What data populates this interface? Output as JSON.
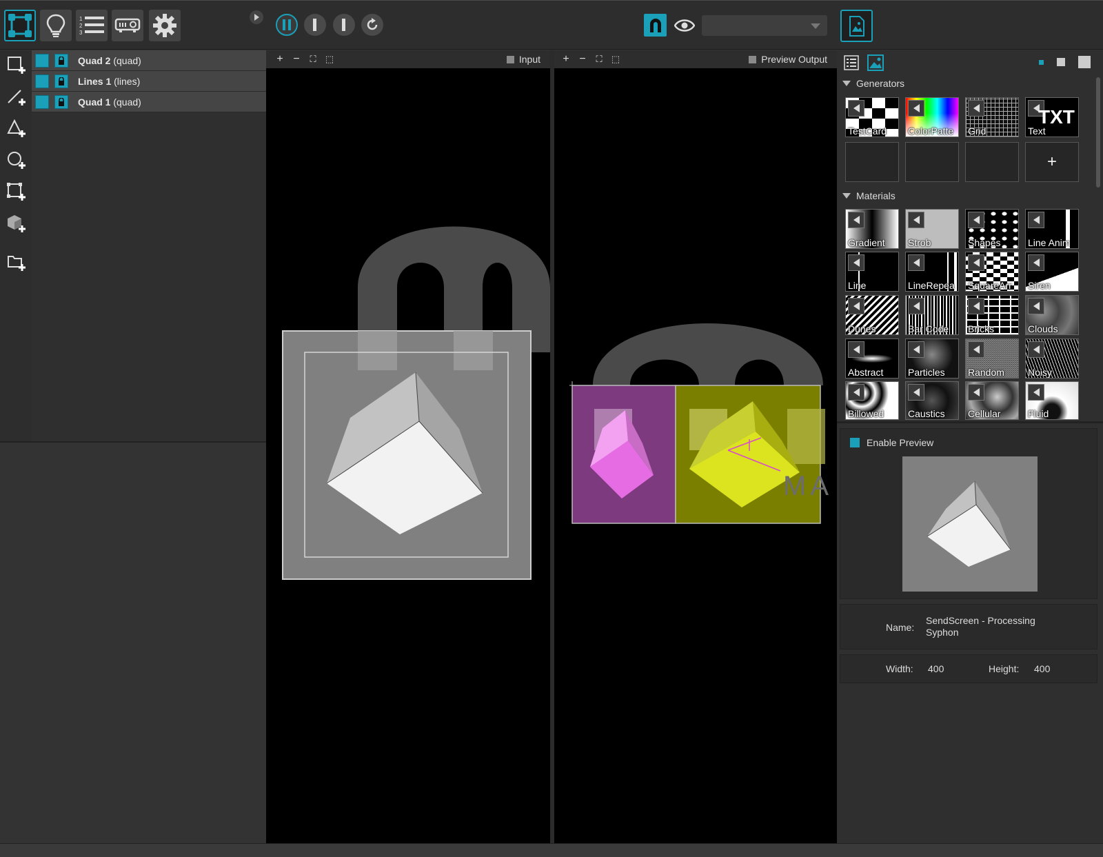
{
  "layers": [
    {
      "name": "Quad 2",
      "type": "(quad)"
    },
    {
      "name": "Lines 1",
      "type": "(lines)"
    },
    {
      "name": "Quad 1",
      "type": "(quad)"
    }
  ],
  "input_panel": {
    "label": "Input",
    "zoom_in": "+",
    "zoom_out": "−",
    "fit": "⛶",
    "actual": "⬚"
  },
  "output_panel": {
    "label": "Preview Output",
    "zoom_in": "+",
    "zoom_out": "−",
    "fit": "⛶",
    "actual": "⬚"
  },
  "output_overlay_text": "MA",
  "generators": {
    "title": "Generators",
    "items": [
      "TestCard",
      "ColorPatte",
      "Grid",
      "Text"
    ],
    "add_label": "+"
  },
  "text_generator_glyph": "TXT",
  "materials": {
    "title": "Materials",
    "items": [
      "Gradient",
      "Strob",
      "Shapes",
      "Line Anim",
      "Line",
      "LineRepea",
      "SquareArr",
      "Siren",
      "Dunes",
      "Bar Code",
      "Bricks",
      "Clouds",
      "Abstract",
      "Particles",
      "Random",
      "Noisy",
      "Billowed",
      "Caustics",
      "Cellular",
      "Fluid"
    ]
  },
  "preview": {
    "enable_label": "Enable Preview",
    "enabled": true
  },
  "source_info": {
    "name_label": "Name:",
    "name_value": "SendScreen - Processing Syphon",
    "width_label": "Width:",
    "width_value": "400",
    "height_label": "Height:",
    "height_value": "400"
  },
  "colors": {
    "accent": "#1aa0b8",
    "magenta_quad": "#7d3a7f",
    "yellow_quad": "#7a7f00"
  }
}
